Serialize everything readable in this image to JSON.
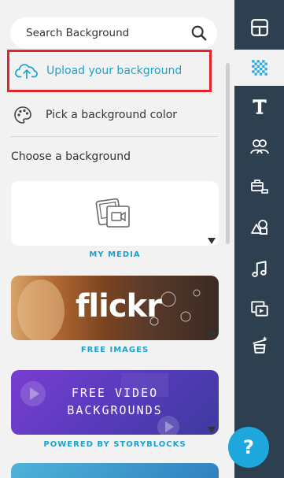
{
  "search": {
    "placeholder": "Search Background",
    "icon": "search-icon"
  },
  "upload": {
    "label": "Upload your background",
    "icon": "cloud-upload-icon",
    "highlight_color": "#e8232e"
  },
  "pick_color": {
    "label": "Pick a background color",
    "icon": "palette-icon"
  },
  "section_title": "Choose a background",
  "cards": [
    {
      "caption": "MY MEDIA",
      "icon": "media-icon"
    },
    {
      "caption": "FREE IMAGES",
      "image_text": "flickr"
    },
    {
      "caption": "POWERED BY STORYBLOCKS",
      "image_text_line1": "FREE VIDEO",
      "image_text_line2": "BACKGROUNDS"
    }
  ],
  "toolbar": {
    "items": [
      {
        "name": "layout-icon"
      },
      {
        "name": "background-icon",
        "active": true
      },
      {
        "name": "text-icon"
      },
      {
        "name": "characters-icon"
      },
      {
        "name": "props-icon"
      },
      {
        "name": "shapes-icon"
      },
      {
        "name": "music-icon"
      },
      {
        "name": "video-icon"
      },
      {
        "name": "effects-icon"
      }
    ]
  },
  "help": {
    "label": "?"
  },
  "colors": {
    "accent": "#1aa2cf",
    "toolbar_bg": "#2e3f4f",
    "help_bg": "#1ea7dd"
  }
}
